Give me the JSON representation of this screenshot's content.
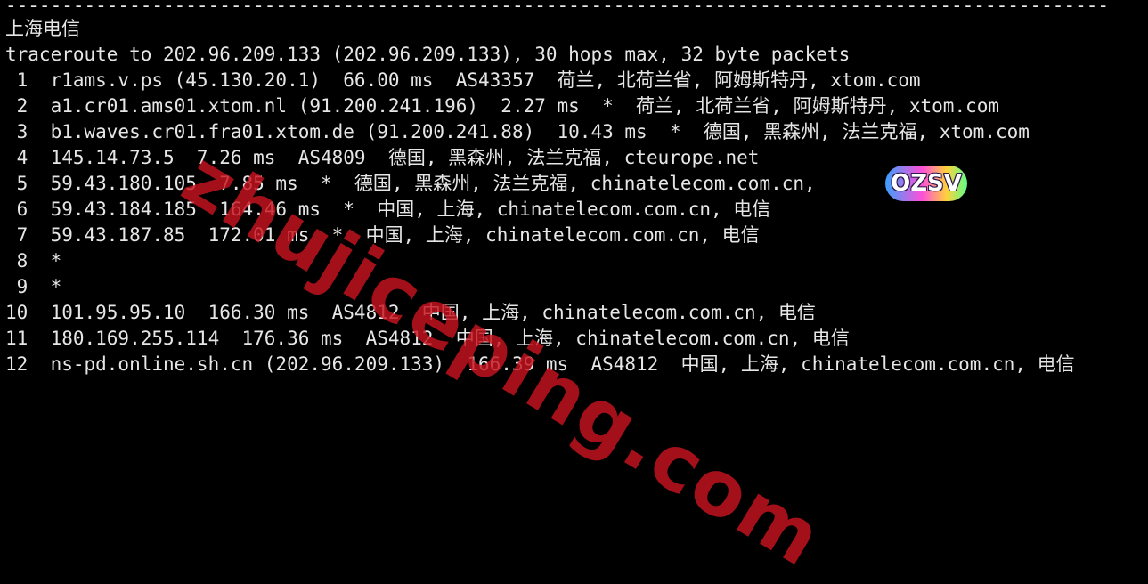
{
  "terminal": {
    "separator": "--------------------------------------------------------------------------------------------------",
    "header": "上海电信",
    "command": "traceroute to 202.96.209.133 (202.96.209.133), 30 hops max, 32 byte packets",
    "hops": [
      " 1  r1ams.v.ps (45.130.20.1)  66.00 ms  AS43357  荷兰, 北荷兰省, 阿姆斯特丹, xtom.com",
      " 2  a1.cr01.ams01.xtom.nl (91.200.241.196)  2.27 ms  *  荷兰, 北荷兰省, 阿姆斯特丹, xtom.com",
      " 3  b1.waves.cr01.fra01.xtom.de (91.200.241.88)  10.43 ms  *  德国, 黑森州, 法兰克福, xtom.com",
      " 4  145.14.73.5  7.26 ms  AS4809  德国, 黑森州, 法兰克福, cteurope.net",
      " 5  59.43.180.105  7.85 ms  *  德国, 黑森州, 法兰克福, chinatelecom.com.cn,",
      " 6  59.43.184.185  164.46 ms  *  中国, 上海, chinatelecom.com.cn, 电信",
      " 7  59.43.187.85  172.01 ms  *  中国, 上海, chinatelecom.com.cn, 电信",
      " 8  *",
      " 9  *",
      "10  101.95.95.10  166.30 ms  AS4812  中国, 上海, chinatelecom.com.cn, 电信",
      "11  180.169.255.114  176.36 ms  AS4812  中国, 上海, chinatelecom.com.cn, 电信",
      "12  ns-pd.online.sh.cn (202.96.209.133)  166.39 ms  AS4812  中国, 上海, chinatelecom.com.cn, 电信"
    ]
  },
  "overlay": {
    "watermark_text": "zhujiceping.com",
    "badge_text": "OZSV"
  },
  "colors": {
    "background": "#000000",
    "text": "#e6e6e6",
    "watermark": "#c8141e"
  }
}
